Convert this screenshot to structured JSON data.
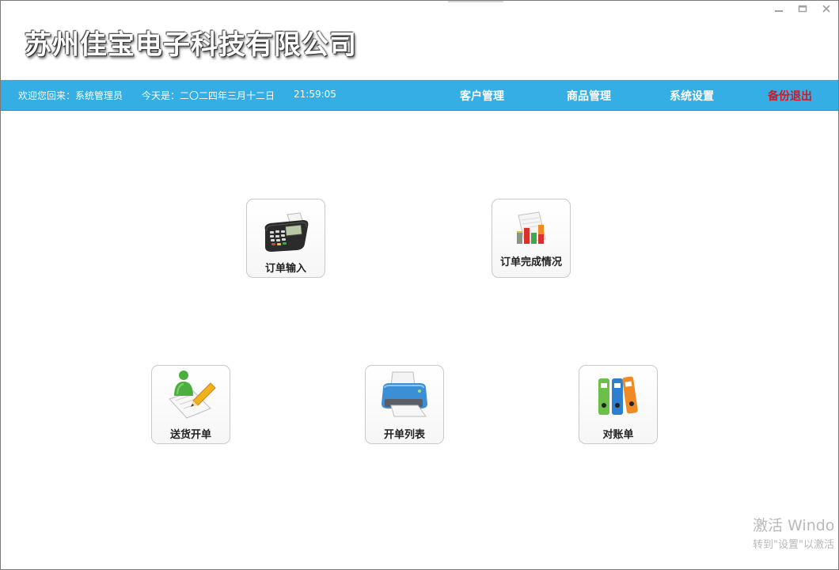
{
  "window": {
    "controls": {
      "minimize": "—",
      "restore": "▭",
      "close": "✕"
    }
  },
  "header": {
    "company_name": "苏州佳宝电子科技有限公司"
  },
  "navbar": {
    "welcome": "欢迎您回来：系统管理员",
    "today": "今天是：二〇二四年三月十二日",
    "time": "21:59:05",
    "links": [
      {
        "label": "客户管理"
      },
      {
        "label": "商品管理"
      },
      {
        "label": "系统设置"
      },
      {
        "label": "备份退出",
        "color": "#e8101a"
      }
    ],
    "bg_color": "#34aee4"
  },
  "tiles": [
    {
      "label": "订单输入",
      "icon": "pos-terminal-icon"
    },
    {
      "label": "订单完成情况",
      "icon": "bar-chart-report-icon"
    },
    {
      "label": "送货开单",
      "icon": "user-pencil-document-icon"
    },
    {
      "label": "开单列表",
      "icon": "printer-icon"
    },
    {
      "label": "对账单",
      "icon": "binders-icon"
    }
  ],
  "watermark": {
    "line1": "激活 Windo",
    "line2": "转到\"设置\"以激活"
  }
}
